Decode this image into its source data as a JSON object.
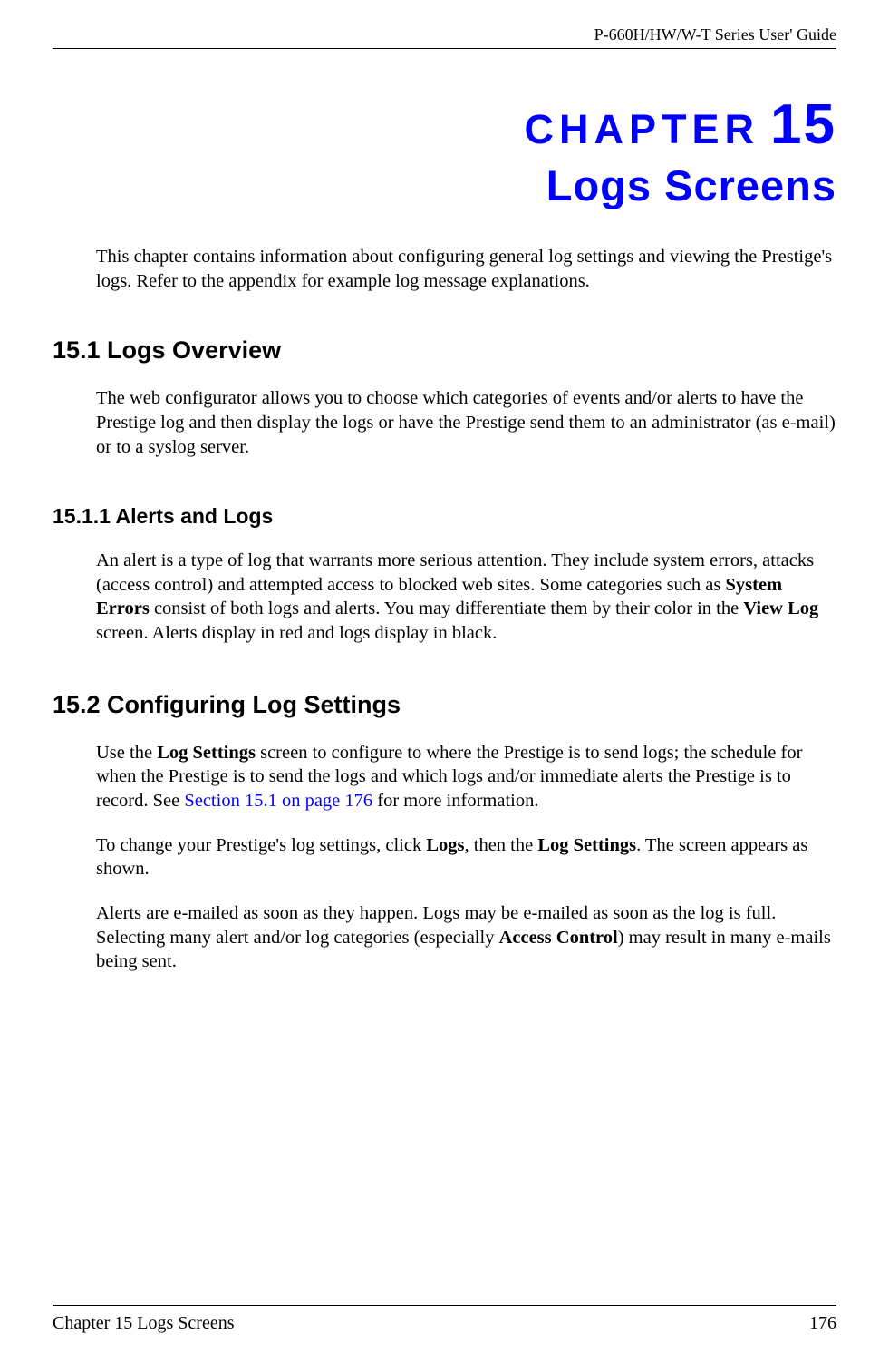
{
  "header": {
    "guide_title": "P-660H/HW/W-T Series User' Guide"
  },
  "chapter": {
    "label": "CHAPTER",
    "number": "15",
    "title": "Logs Screens"
  },
  "intro": "This chapter contains information about configuring general log settings and viewing the Prestige's logs. Refer to the appendix for example log message explanations.",
  "sections": {
    "s15_1": {
      "heading": "15.1  Logs Overview",
      "body": "The web configurator allows you to choose which categories of events and/or alerts to have the Prestige log and then display the logs or have the Prestige send them to an administrator (as e-mail) or to a syslog server."
    },
    "s15_1_1": {
      "heading": "15.1.1  Alerts and Logs",
      "body_pre": "An alert is a type of log that warrants more serious attention. They include system errors, attacks (access control) and attempted access to blocked web sites. Some categories such as ",
      "bold1": "System Errors",
      "body_mid": " consist of both logs and alerts. You may differentiate them by their color in the ",
      "bold2": "View Log",
      "body_end": " screen. Alerts display in red and logs display in black."
    },
    "s15_2": {
      "heading": "15.2  Configuring Log Settings",
      "p1_pre": "Use the ",
      "p1_bold1": "Log Settings",
      "p1_mid": " screen to configure to where the Prestige is to send logs; the schedule for when the Prestige is to send the logs and which logs and/or immediate alerts the Prestige is to record. See ",
      "p1_link": "Section 15.1 on page 176",
      "p1_end": " for more information.",
      "p2_pre": "To change your Prestige's log settings, click ",
      "p2_bold1": "Logs",
      "p2_mid": ", then the ",
      "p2_bold2": "Log Settings",
      "p2_end": ". The screen appears as shown.",
      "p3_pre": "Alerts are e-mailed as soon as they happen. Logs may be e-mailed as soon as the log is full. Selecting many alert and/or log categories (especially ",
      "p3_bold1": "Access Control",
      "p3_end": ") may result in many e-mails being sent."
    }
  },
  "footer": {
    "chapter_label": "Chapter 15 Logs Screens",
    "page_number": "176"
  }
}
